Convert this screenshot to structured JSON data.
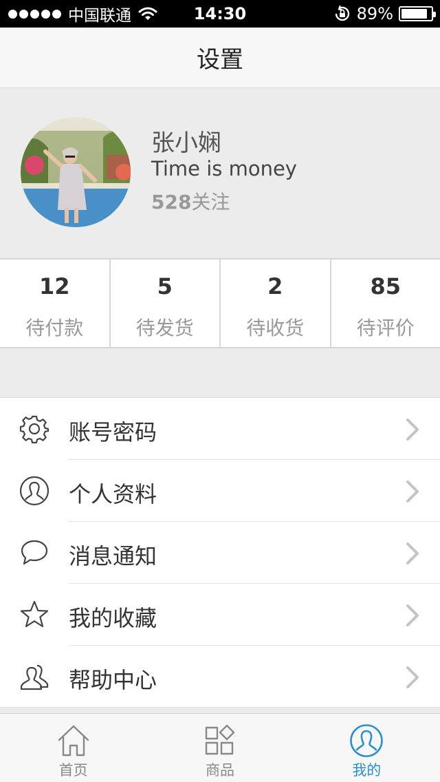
{
  "status_bar": {
    "carrier": "中国联通",
    "time": "14:30",
    "battery_percent": "89%",
    "battery_level": 0.89,
    "icons": [
      "signal-dots-icon",
      "wifi-icon",
      "rotation-lock-icon",
      "battery-icon"
    ]
  },
  "nav": {
    "title": "设置"
  },
  "profile": {
    "name": "张小娴",
    "motto": "Time is money",
    "follow_count": "528",
    "follow_label": "关注"
  },
  "order_stats": [
    {
      "count": "12",
      "label": "待付款"
    },
    {
      "count": "5",
      "label": "待发货"
    },
    {
      "count": "2",
      "label": "待收货"
    },
    {
      "count": "85",
      "label": "待评价"
    }
  ],
  "menu": [
    {
      "label": "账号密码",
      "icon": "gear-icon"
    },
    {
      "label": "个人资料",
      "icon": "user-circle-icon"
    },
    {
      "label": "消息通知",
      "icon": "chat-bubble-icon"
    },
    {
      "label": "我的收藏",
      "icon": "star-icon"
    },
    {
      "label": "帮助中心",
      "icon": "users-icon"
    }
  ],
  "tabs": [
    {
      "label": "首页",
      "icon": "home-icon",
      "active": false
    },
    {
      "label": "商品",
      "icon": "grid-icon",
      "active": false
    },
    {
      "label": "我的",
      "icon": "user-circle-icon",
      "active": true
    }
  ],
  "colors": {
    "accent": "#2a8fd6",
    "background": "#ececec",
    "status_bar": "#000000",
    "secondary_text": "#999999"
  }
}
